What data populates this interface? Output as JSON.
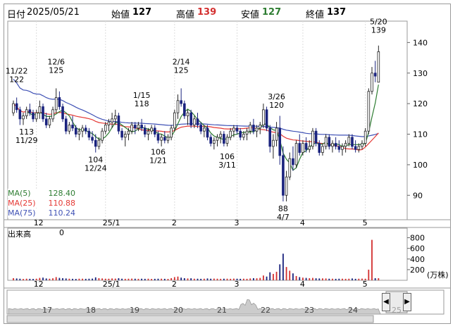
{
  "header": {
    "date_label": "日付",
    "date": "2025/05/21",
    "open_label": "始値",
    "open": "127",
    "high_label": "高値",
    "high": "139",
    "low_label": "安値",
    "low": "127",
    "close_label": "終値",
    "close": "137"
  },
  "legend": {
    "ma5_label": "MA(5)",
    "ma5_value": "128.40",
    "ma25_label": "MA(25)",
    "ma25_value": "110.88",
    "ma75_label": "MA(75)",
    "ma75_value": "110.24",
    "ma5_color": "#2e7d32",
    "ma25_color": "#e53935",
    "ma75_color": "#3f51b5"
  },
  "volume": {
    "label": "出来高",
    "value": "0",
    "unit": "(万株)"
  },
  "colors": {
    "up": "#222222",
    "down": "#1a237e",
    "volume_up": "#d32f2f",
    "volume_down": "#1a237e"
  },
  "navigator": {
    "labels": [
      "17",
      "18",
      "19",
      "20",
      "21",
      "22",
      "23",
      "24",
      "25"
    ],
    "left_icon": "chevron-left-icon",
    "right_icon": "chevron-right-icon"
  },
  "chart_data": {
    "type": "candlestick",
    "y_range": [
      82,
      147
    ],
    "y_ticks": [
      "140",
      "130",
      "120",
      "110",
      "100",
      "90"
    ],
    "volume_range": [
      0,
      900
    ],
    "volume_ticks": [
      "800",
      "600",
      "400",
      "200"
    ],
    "x_ticks": [
      "12",
      "25/1",
      "2",
      "3",
      "4",
      "5"
    ],
    "annotations": [
      {
        "date": "11/22",
        "value": "122"
      },
      {
        "date": "11/29",
        "value": "113"
      },
      {
        "date": "12/6",
        "value": "125"
      },
      {
        "date": "12/24",
        "value": "104"
      },
      {
        "date": "1/15",
        "value": "118"
      },
      {
        "date": "1/21",
        "value": "106"
      },
      {
        "date": "2/14",
        "value": "125"
      },
      {
        "date": "3/11",
        "value": "106"
      },
      {
        "date": "3/26",
        "value": "120"
      },
      {
        "date": "4/7",
        "value": "88"
      },
      {
        "date": "5/20",
        "value": "139"
      }
    ],
    "candles": [
      [
        117,
        121,
        116,
        120
      ],
      [
        120,
        122,
        117,
        118
      ],
      [
        118,
        119,
        113,
        115
      ],
      [
        115,
        117,
        113,
        116
      ],
      [
        116,
        119,
        115,
        118
      ],
      [
        118,
        120,
        116,
        117
      ],
      [
        117,
        118,
        114,
        115
      ],
      [
        115,
        118,
        114,
        117
      ],
      [
        117,
        121,
        115,
        119
      ],
      [
        119,
        120,
        114,
        115
      ],
      [
        115,
        117,
        112,
        113
      ],
      [
        113,
        116,
        112,
        115
      ],
      [
        115,
        119,
        114,
        118
      ],
      [
        118,
        125,
        117,
        122
      ],
      [
        122,
        124,
        118,
        119
      ],
      [
        119,
        120,
        114,
        115
      ],
      [
        115,
        116,
        110,
        111
      ],
      [
        111,
        114,
        110,
        113
      ],
      [
        113,
        116,
        111,
        112
      ],
      [
        112,
        113,
        109,
        110
      ],
      [
        110,
        112,
        108,
        111
      ],
      [
        111,
        113,
        109,
        112
      ],
      [
        112,
        113,
        110,
        111
      ],
      [
        111,
        112,
        108,
        109
      ],
      [
        109,
        111,
        107,
        108
      ],
      [
        108,
        110,
        104,
        106
      ],
      [
        106,
        109,
        105,
        108
      ],
      [
        108,
        112,
        107,
        111
      ],
      [
        111,
        114,
        110,
        113
      ],
      [
        113,
        115,
        111,
        114
      ],
      [
        114,
        117,
        112,
        115
      ],
      [
        115,
        118,
        113,
        116
      ],
      [
        116,
        117,
        110,
        111
      ],
      [
        111,
        112,
        108,
        109
      ],
      [
        109,
        111,
        106,
        110
      ],
      [
        110,
        112,
        108,
        111
      ],
      [
        111,
        114,
        110,
        113
      ],
      [
        113,
        114,
        110,
        112
      ],
      [
        112,
        114,
        111,
        113
      ],
      [
        113,
        115,
        111,
        112
      ],
      [
        112,
        113,
        109,
        110
      ],
      [
        110,
        112,
        108,
        111
      ],
      [
        111,
        113,
        110,
        112
      ],
      [
        112,
        113,
        109,
        110
      ],
      [
        110,
        111,
        107,
        108
      ],
      [
        108,
        110,
        106,
        109
      ],
      [
        109,
        111,
        107,
        108
      ],
      [
        108,
        110,
        107,
        109
      ],
      [
        109,
        113,
        108,
        112
      ],
      [
        112,
        118,
        111,
        117
      ],
      [
        117,
        123,
        115,
        121
      ],
      [
        121,
        125,
        119,
        120
      ],
      [
        120,
        121,
        115,
        116
      ],
      [
        116,
        118,
        113,
        117
      ],
      [
        117,
        118,
        112,
        113
      ],
      [
        113,
        116,
        112,
        115
      ],
      [
        115,
        117,
        112,
        113
      ],
      [
        113,
        114,
        110,
        111
      ],
      [
        111,
        113,
        109,
        112
      ],
      [
        112,
        113,
        108,
        109
      ],
      [
        109,
        110,
        106,
        107
      ],
      [
        107,
        109,
        105,
        108
      ],
      [
        108,
        110,
        106,
        109
      ],
      [
        109,
        111,
        107,
        110
      ],
      [
        110,
        111,
        106,
        107
      ],
      [
        107,
        110,
        106,
        109
      ],
      [
        109,
        112,
        108,
        111
      ],
      [
        111,
        113,
        109,
        112
      ],
      [
        112,
        113,
        110,
        111
      ],
      [
        111,
        112,
        108,
        109
      ],
      [
        109,
        111,
        108,
        110
      ],
      [
        110,
        112,
        108,
        111
      ],
      [
        111,
        114,
        110,
        113
      ],
      [
        113,
        115,
        110,
        111
      ],
      [
        111,
        113,
        109,
        112
      ],
      [
        112,
        114,
        110,
        113
      ],
      [
        113,
        120,
        112,
        118
      ],
      [
        118,
        119,
        111,
        112
      ],
      [
        112,
        113,
        104,
        106
      ],
      [
        106,
        110,
        102,
        108
      ],
      [
        108,
        114,
        106,
        112
      ],
      [
        112,
        116,
        100,
        103
      ],
      [
        103,
        106,
        88,
        90
      ],
      [
        90,
        98,
        88,
        96
      ],
      [
        96,
        104,
        95,
        102
      ],
      [
        102,
        106,
        98,
        100
      ],
      [
        100,
        108,
        99,
        107
      ],
      [
        107,
        110,
        103,
        104
      ],
      [
        104,
        108,
        103,
        107
      ],
      [
        107,
        109,
        104,
        105
      ],
      [
        105,
        108,
        104,
        106
      ],
      [
        106,
        112,
        105,
        111
      ],
      [
        111,
        112,
        106,
        107
      ],
      [
        107,
        108,
        103,
        104
      ],
      [
        104,
        107,
        103,
        106
      ],
      [
        106,
        110,
        105,
        109
      ],
      [
        109,
        110,
        105,
        106
      ],
      [
        106,
        108,
        104,
        107
      ],
      [
        107,
        109,
        105,
        106
      ],
      [
        106,
        108,
        104,
        105
      ],
      [
        105,
        107,
        103,
        106
      ],
      [
        106,
        108,
        104,
        107
      ],
      [
        107,
        110,
        106,
        109
      ],
      [
        109,
        110,
        105,
        106
      ],
      [
        106,
        108,
        104,
        105
      ],
      [
        105,
        107,
        104,
        106
      ],
      [
        106,
        108,
        105,
        107
      ],
      [
        107,
        112,
        106,
        111
      ],
      [
        111,
        125,
        110,
        124
      ],
      [
        124,
        132,
        123,
        130
      ],
      [
        130,
        134,
        127,
        129
      ],
      [
        127,
        139,
        127,
        137
      ]
    ],
    "volume": [
      40,
      35,
      30,
      25,
      30,
      28,
      26,
      30,
      45,
      50,
      35,
      30,
      38,
      60,
      45,
      40,
      35,
      30,
      28,
      26,
      30,
      30,
      28,
      30,
      32,
      55,
      40,
      35,
      30,
      30,
      35,
      32,
      40,
      30,
      28,
      30,
      32,
      30,
      28,
      30,
      28,
      30,
      26,
      28,
      30,
      30,
      28,
      26,
      40,
      60,
      70,
      50,
      40,
      35,
      38,
      30,
      30,
      28,
      30,
      35,
      30,
      32,
      30,
      28,
      30,
      30,
      28,
      32,
      30,
      28,
      30,
      28,
      35,
      40,
      38,
      45,
      90,
      70,
      150,
      120,
      160,
      300,
      500,
      250,
      180,
      130,
      80,
      60,
      50,
      45,
      40,
      45,
      38,
      35,
      36,
      35,
      30,
      30,
      28,
      30,
      30,
      28,
      30,
      35,
      28,
      30,
      32,
      30,
      200,
      760,
      40,
      40,
      25,
      25,
      110,
      120
    ],
    "ma5": [],
    "ma25": [],
    "ma75": []
  }
}
